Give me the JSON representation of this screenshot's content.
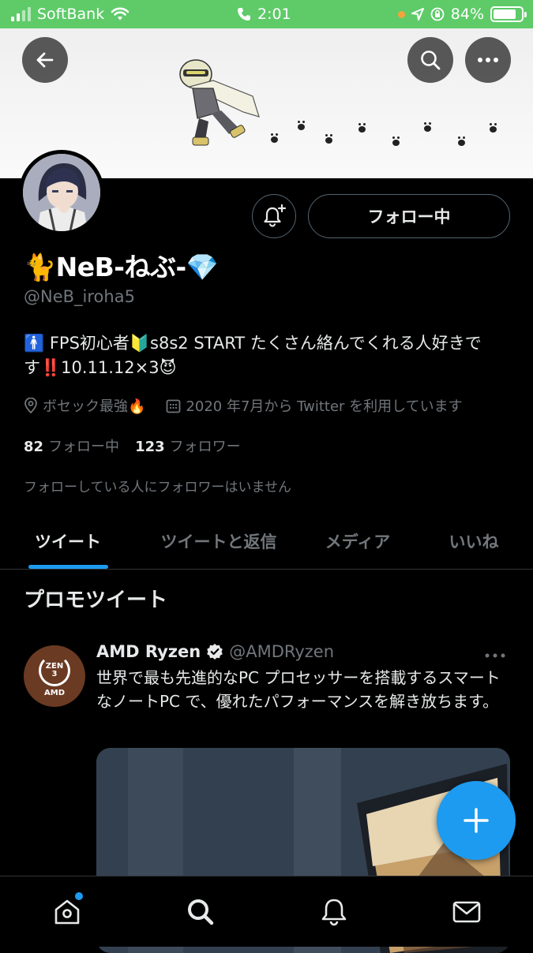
{
  "status_bar": {
    "carrier": "SoftBank",
    "time": "2:01",
    "battery": "84%"
  },
  "header": {
    "back_icon": "arrow-left-icon",
    "search_icon": "search-icon",
    "more_icon": "more-horizontal-icon"
  },
  "profile": {
    "name": "🐈NeB-ねぶ-💎",
    "handle": "@NeB_iroha5",
    "bio": "🚹 FPS初心者🔰s8s2 START たくさん絡んでくれる人好きです‼️10.11.12×3😈",
    "location": "ボセック最強🔥",
    "joined": "2020 年7月から Twitter を利用しています",
    "following_count": "82",
    "following_label": "フォロー中",
    "followers_count": "123",
    "followers_label": "フォロワー",
    "followed_by_note": "フォローしている人にフォロワーはいません",
    "follow_button_label": "フォロー中"
  },
  "tabs": [
    {
      "label": "ツイート",
      "active": true
    },
    {
      "label": "ツイートと返信",
      "active": false
    },
    {
      "label": "メディア",
      "active": false
    },
    {
      "label": "いいね",
      "active": false
    }
  ],
  "promo_section": {
    "heading": "プロモツイート",
    "tweet": {
      "author": "AMD Ryzen",
      "verified": true,
      "handle": "@AMDRyzen",
      "text": "世界で最も先進的なPC プロセッサーを搭載するスマートなノートPC で、優れたパフォーマンスを解き放ちます。",
      "avatar_text_top": "ZEN",
      "avatar_text_num": "3",
      "avatar_logo": "AMD"
    }
  },
  "fab": {
    "icon": "plus-icon"
  },
  "bottom_nav": [
    {
      "icon": "home-icon",
      "has_notification_dot": true
    },
    {
      "icon": "search-icon"
    },
    {
      "icon": "bell-icon"
    },
    {
      "icon": "mail-icon"
    }
  ],
  "colors": {
    "accent": "#1d9bf0",
    "status_bar": "#5ecb68",
    "background": "#000000",
    "secondary_text": "#71767b"
  }
}
